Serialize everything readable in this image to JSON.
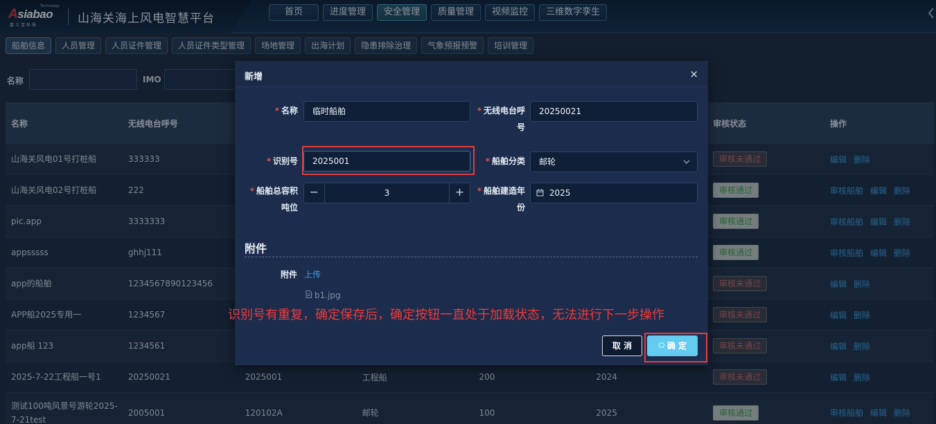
{
  "header": {
    "logo_text": "Asiabao",
    "logo_tm": "Technology",
    "logo_sub": "嘉士宝科技",
    "app_title": "山海关海上风电智慧平台",
    "nav": [
      {
        "label": "首页"
      },
      {
        "label": "进度管理"
      },
      {
        "label": "安全管理"
      },
      {
        "label": "质量管理"
      },
      {
        "label": "视频监控"
      },
      {
        "label": "三维数字孪生"
      }
    ],
    "active_nav": "安全管理"
  },
  "sub_nav": [
    {
      "label": "船舶信息"
    },
    {
      "label": "人员管理"
    },
    {
      "label": "人员证件管理"
    },
    {
      "label": "人员证件类型管理"
    },
    {
      "label": "场地管理"
    },
    {
      "label": "出海计划"
    },
    {
      "label": "隐患排除治理"
    },
    {
      "label": "气象预报预警"
    },
    {
      "label": "培训管理"
    }
  ],
  "filters": {
    "name_label": "名称",
    "imo_label": "IMO"
  },
  "table": {
    "headers": [
      "名称",
      "无线电台呼号",
      "",
      "",
      "",
      "",
      "审核状态",
      "操作"
    ],
    "rows": [
      {
        "name": "山海关风电01号打桩船",
        "callsign": "333333",
        "id": "",
        "type": "",
        "tonnage": "",
        "year": "",
        "status": "审核未通过",
        "ops": [
          "编辑",
          "删除"
        ]
      },
      {
        "name": "山海关风电02号打桩船",
        "callsign": "222",
        "id": "",
        "type": "",
        "tonnage": "",
        "year": "",
        "status": "审核通过",
        "ops": [
          "审核船舶",
          "编辑",
          "删除"
        ]
      },
      {
        "name": "pic.app",
        "callsign": "3333333",
        "id": "",
        "type": "",
        "tonnage": "",
        "year": "",
        "status": "审核通过",
        "ops": [
          "审核船舶",
          "编辑",
          "删除"
        ]
      },
      {
        "name": "appsssss",
        "callsign": "ghhj111",
        "id": "",
        "type": "",
        "tonnage": "",
        "year": "",
        "status": "审核通过",
        "ops": [
          "审核船舶",
          "编辑",
          "删除"
        ]
      },
      {
        "name": "app的船舶",
        "callsign": "1234567890123456",
        "id": "",
        "type": "",
        "tonnage": "",
        "year": "",
        "status": "审核未通过",
        "ops": [
          "编辑",
          "删除"
        ]
      },
      {
        "name": "APP船2025专用一",
        "callsign": "1234567",
        "id": "",
        "type": "",
        "tonnage": "",
        "year": "",
        "status": "审核未通过",
        "ops": [
          "编辑",
          "删除"
        ]
      },
      {
        "name": "app船 123",
        "callsign": "1234561",
        "id": "",
        "type": "",
        "tonnage": "",
        "year": "",
        "status": "审核未通过",
        "ops": [
          "编辑",
          "删除"
        ]
      },
      {
        "name": "2025-7-22工程船一号1",
        "callsign": "20250021",
        "id": "2025001",
        "type": "工程船",
        "tonnage": "200",
        "year": "2024",
        "status": "审核未通过",
        "ops": [
          "编辑",
          "删除"
        ]
      },
      {
        "name": "测试100吨风景号游轮2025-7-21test",
        "callsign": "2005001",
        "id": "120102A",
        "type": "邮轮",
        "tonnage": "100",
        "year": "2025",
        "status": "审核通过",
        "ops": [
          "审核船舶",
          "编辑",
          "删除"
        ]
      }
    ]
  },
  "dialog": {
    "title": "新增",
    "close": "×",
    "fields": {
      "name_label": "名称",
      "name_value": "临时船舶",
      "callsign_label": "无线电台呼号",
      "callsign_value": "20250021",
      "id_label": "识别号",
      "id_value": "2025001",
      "category_label": "船舶分类",
      "category_value": "邮轮",
      "tonnage_label": "船舶总容积吨位",
      "tonnage_value": "3",
      "minus": "−",
      "plus": "+",
      "year_label": "船舶建造年份",
      "year_value": "2025",
      "calendar_icon": "calendar-icon"
    },
    "attachment": {
      "section_title": "附件",
      "label": "附件",
      "upload": "上传",
      "file": "b1.jpg"
    },
    "buttons": {
      "cancel": "取 消",
      "confirm": "确 定"
    }
  },
  "annotation": {
    "text": "识别号有重复，确定保存后，确定按钮一直处于加载状态，无法进行下一步操作",
    "color": "#ee3a3a"
  }
}
